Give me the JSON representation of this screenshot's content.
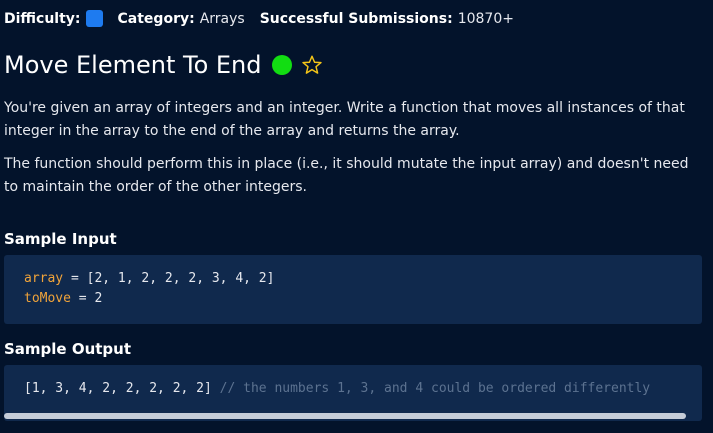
{
  "meta": {
    "difficulty_label": "Difficulty:",
    "difficulty_color": "#1e7bf0",
    "category_label": "Category:",
    "category_value": "Arrays",
    "submissions_label": "Successful Submissions:",
    "submissions_value": "10870+"
  },
  "question": {
    "title": "Move Element To End",
    "status_color": "#12dd12",
    "star_icon": "star-outline-icon",
    "paragraph_1": "You're given an array of integers and an integer. Write a function that moves all instances of that integer in the array to the end of the array and returns the array.",
    "paragraph_2": "The function should perform this in place (i.e., it should mutate the input array) and doesn't need to maintain the order of the other integers."
  },
  "sample_input": {
    "heading": "Sample Input",
    "line1_var": "array",
    "line1_rest": " = [2, 1, 2, 2, 2, 3, 4, 2]",
    "line2_var": "toMove",
    "line2_rest": " = 2"
  },
  "sample_output": {
    "heading": "Sample Output",
    "value": "[1, 3, 4, 2, 2, 2, 2, 2]",
    "comment": " // the numbers 1, 3, and 4 could be ordered differently"
  }
}
